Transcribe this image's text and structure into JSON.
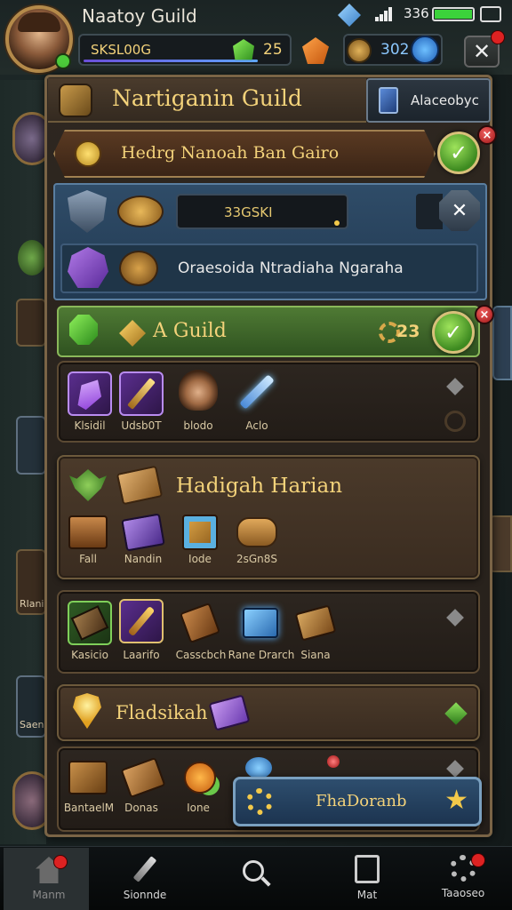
{
  "header": {
    "title": "Naatoy Guild",
    "currency_label": "SKSL00G",
    "gem_count": "25",
    "coin_count": "302",
    "battery_text": "336"
  },
  "guild_panel": {
    "title": "Nartiganin Guild",
    "side_button": "Alaceobyc",
    "banner_text": "Hedrg Nanoah Ban Gairo",
    "input_value": "33GSKI",
    "info_text": "Oraesoida Ntradiaha Ngaraha"
  },
  "section_a": {
    "title": "A Guild",
    "count": "23",
    "items": [
      {
        "label": "Klsidil",
        "icon": "amethyst-crystal-icon"
      },
      {
        "label": "Udsb0T",
        "icon": "golden-sword-icon"
      },
      {
        "label": "blodo",
        "icon": "warrior-avatar-icon"
      },
      {
        "label": "Aclo",
        "icon": "ice-sword-icon"
      }
    ]
  },
  "section_b": {
    "title": "Hadigah Harian",
    "items": [
      {
        "label": "Fall",
        "icon": "chest-icon"
      },
      {
        "label": "Nandin",
        "icon": "spellbook-icon"
      },
      {
        "label": "Iode",
        "icon": "key-scroll-icon"
      },
      {
        "label": "2sGn8S",
        "icon": "bread-icon"
      }
    ]
  },
  "section_c": {
    "items": [
      {
        "label": "Kasicio",
        "icon": "green-book-icon"
      },
      {
        "label": "Laarifo",
        "icon": "torch-icon"
      },
      {
        "label": "Casscbch",
        "icon": "leather-boots-icon"
      },
      {
        "label": "Rane Drarch",
        "icon": "blue-chest-icon"
      },
      {
        "label": "Siana",
        "icon": "wooden-chest-icon"
      }
    ]
  },
  "section_d": {
    "title": "Fladsikah"
  },
  "section_e": {
    "items": [
      {
        "label": "BantaelM",
        "icon": "wooden-box-icon"
      },
      {
        "label": "Donas",
        "icon": "cart-icon"
      },
      {
        "label": "Ione",
        "icon": "orange-gems-icon"
      }
    ],
    "action_button": "FhaDoranb"
  },
  "left_rail": {
    "labels": [
      "Rlani",
      "Saene"
    ]
  },
  "bottom_nav": [
    {
      "label": "Manm",
      "icon": "home-icon"
    },
    {
      "label": "Sionnde",
      "icon": "sword-icon"
    },
    {
      "label": "",
      "icon": "search-icon"
    },
    {
      "label": "Mat",
      "icon": "shop-icon"
    },
    {
      "label": "Taaoseo",
      "icon": "gear-icon"
    }
  ],
  "colors": {
    "wood": "#4b3a2a",
    "green_bar": "#3f6b2a",
    "blue_panel": "#29445f",
    "gold_text": "#f3d27a"
  }
}
